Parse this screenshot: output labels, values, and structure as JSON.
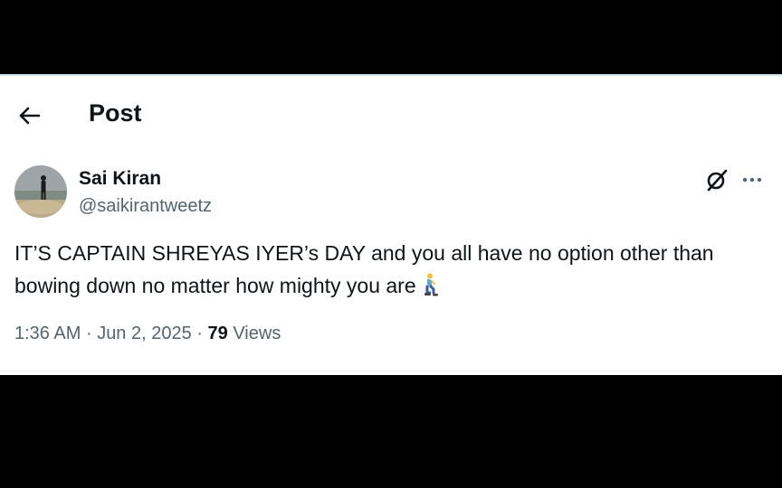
{
  "header": {
    "title": "Post",
    "back_icon": "arrow-left-icon"
  },
  "post": {
    "author_name": "Sai Kiran",
    "author_handle": "@saikirantweetz",
    "text": "IT’S CAPTAIN SHREYAS IYER’s DAY and you all have no option other than bowing down no matter how mighty you are",
    "emoji_icon": "kneeling-man-emoji-icon",
    "time": "1:36 AM",
    "separator": "·",
    "date": "Jun 2, 2025",
    "views_count": "79",
    "views_label": "Views",
    "grok_icon": "grok-icon",
    "more_icon": "more-options-icon"
  },
  "colors": {
    "text_primary": "#0f1419",
    "text_secondary": "#536471",
    "background": "#ffffff",
    "border": "#eff3f4"
  }
}
